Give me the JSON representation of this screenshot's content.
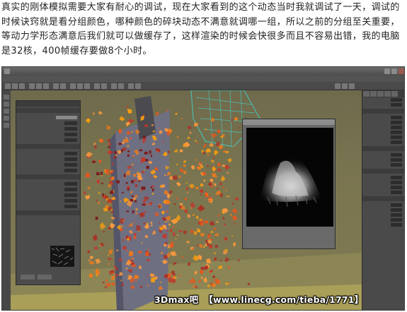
{
  "article": {
    "text": "真实的刚体模拟需要大家有耐心的调试，现在大家看到的这个动态当时我就调试了一天，调试的时候诀窍就是看分组颜色，哪种颜色的碎块动态不满意就调哪一组，所以之前的分组至关重要，等动力学形态满意后我们就可以做缓存了，这样渲染的时候会快很多而且不容易出错，我的电脑是32核，400帧缓存要做8个小时。"
  },
  "watermark": {
    "brand": "3Dmax吧",
    "url": "【www.linecg.com/tieba/1771】"
  },
  "colors": {
    "viewport_bg": "#7a7550",
    "debris_orange": "#f07a1a",
    "debris_red": "#c0392b",
    "cyan_wireframe": "#46c9c0",
    "panel_bg": "#4b4b4b"
  },
  "icons": [
    "window-control-icon",
    "toolbar-button-icon",
    "tool-button-icon",
    "command-tab-icon"
  ]
}
